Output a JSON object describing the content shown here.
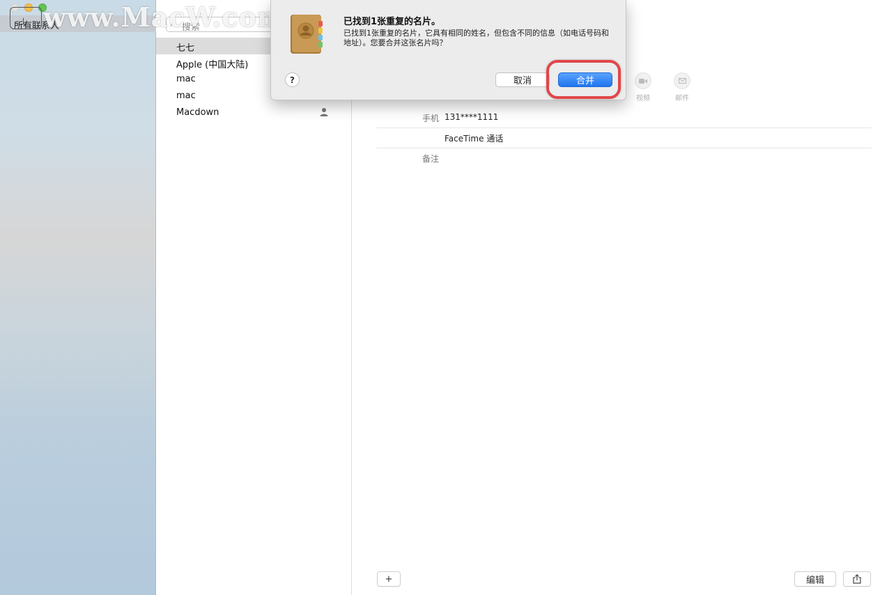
{
  "sidebar": {
    "selected_group": "所有联系人"
  },
  "watermark": "www.MacW.com",
  "search": {
    "placeholder": "搜索"
  },
  "contacts": [
    {
      "name": "七七"
    },
    {
      "name": "Apple (中国大陆)"
    },
    {
      "name": "mac"
    },
    {
      "name": "mac"
    },
    {
      "name": "Macdown"
    }
  ],
  "detail": {
    "actions": [
      {
        "label": "视频",
        "icon": "video-icon"
      },
      {
        "label": "邮件",
        "icon": "mail-icon"
      }
    ],
    "fields": [
      {
        "label": "手机",
        "value": "131****1111"
      },
      {
        "label": "",
        "value": "FaceTime 通话"
      },
      {
        "label": "备注",
        "value": ""
      }
    ],
    "edit_label": "编辑",
    "add_label": "+",
    "share_icon": "share-icon"
  },
  "dialog": {
    "title": "已找到1张重复的名片。",
    "message": "已找到1张重复的名片，它具有相同的姓名，但包含不同的信息（如电话号码和地址）。您要合并这张名片吗？",
    "help_label": "?",
    "cancel_label": "取消",
    "merge_label": "合并"
  },
  "colors": {
    "accent": "#1f75ee",
    "highlight": "#e0474a"
  }
}
